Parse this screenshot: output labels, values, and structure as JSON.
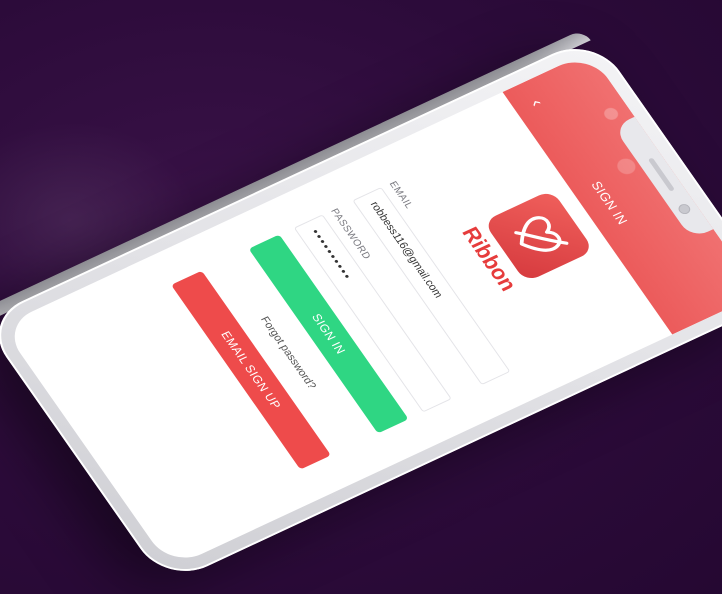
{
  "header": {
    "title": "SIGN IN",
    "back_icon": "chevron-left-icon",
    "color": "#ec5b5b"
  },
  "logo": {
    "word": "Ribbon",
    "color": "#e63c3c"
  },
  "form": {
    "email_label": "EMAIL",
    "email_value": "robbess116@gmail.com",
    "password_label": "PASSWORD",
    "password_value": "••••••••••"
  },
  "buttons": {
    "signin_label": "SIGN IN",
    "signin_color": "#2fd683",
    "forgot_label": "Forgot password?",
    "signup_label": "EMAIL SIGN UP",
    "signup_color": "#ee4b4b"
  },
  "theme": {
    "background": "#2c0b3a"
  }
}
